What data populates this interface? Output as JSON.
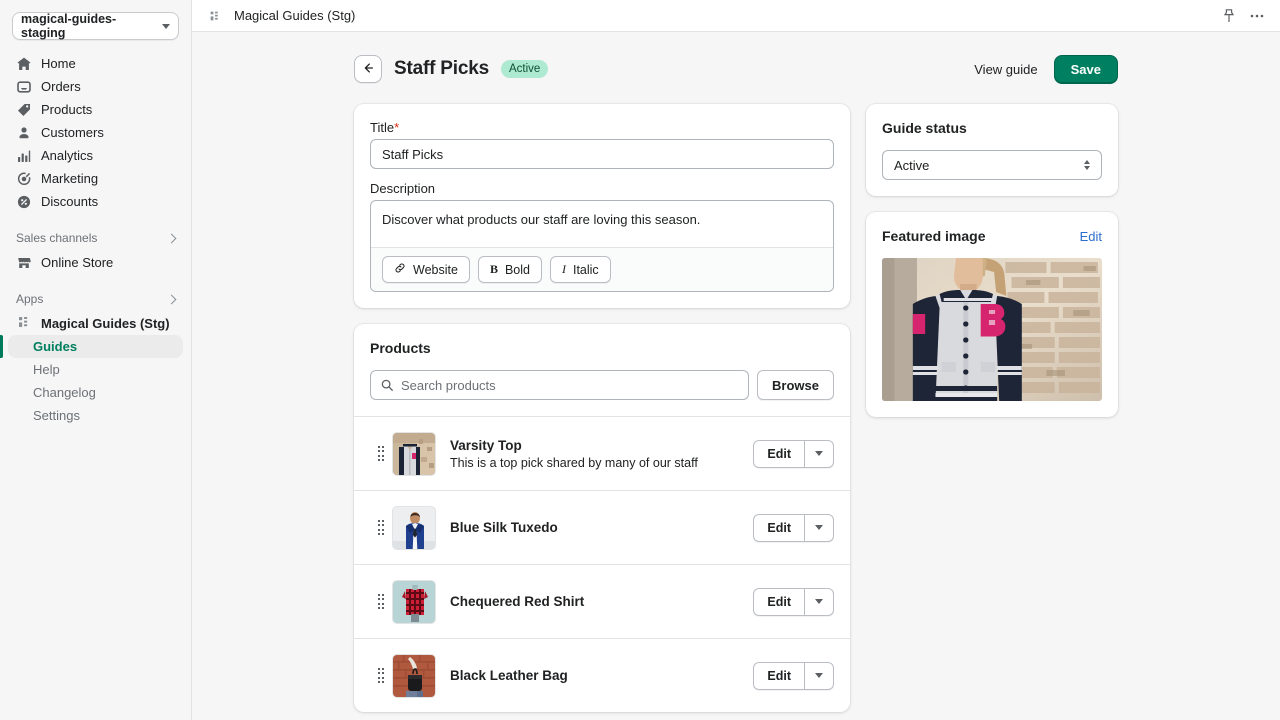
{
  "sidebar": {
    "store_switcher": {
      "label": "magical-guides-staging",
      "icon": "chevron-down-icon"
    },
    "nav_items": [
      {
        "label": "Home",
        "icon": "home-icon"
      },
      {
        "label": "Orders",
        "icon": "orders-inbox-icon"
      },
      {
        "label": "Products",
        "icon": "products-tag-icon"
      },
      {
        "label": "Customers",
        "icon": "customers-person-icon"
      },
      {
        "label": "Analytics",
        "icon": "analytics-bars-icon"
      },
      {
        "label": "Marketing",
        "icon": "marketing-target-icon"
      },
      {
        "label": "Discounts",
        "icon": "discounts-badge-icon"
      }
    ],
    "sales_channels": {
      "label": "Sales channels",
      "icon": "chevron-right-icon"
    },
    "online_store": {
      "label": "Online Store",
      "icon": "storefront-icon"
    },
    "apps_section": {
      "label": "Apps",
      "icon": "chevron-right-icon"
    },
    "app": {
      "label": "Magical Guides (Stg)",
      "icon": "app-grid-icon"
    },
    "app_subnav": [
      {
        "label": "Guides",
        "active": true
      },
      {
        "label": "Help",
        "active": false
      },
      {
        "label": "Changelog",
        "active": false
      },
      {
        "label": "Settings",
        "active": false
      }
    ]
  },
  "topbar": {
    "app_icon": "app-grid-icon",
    "title": "Magical Guides (Stg)",
    "pin_icon": "pin-icon",
    "more_icon": "more-horizontal-icon"
  },
  "page_header": {
    "back_icon": "arrow-left-icon",
    "title": "Staff Picks",
    "status_badge": "Active",
    "view_guide_label": "View guide",
    "save_label": "Save"
  },
  "details_card": {
    "title_label": "Title",
    "title_required": "*",
    "title_value": "Staff Picks",
    "description_label": "Description",
    "description_value": "Discover what products our staff are loving this season.",
    "toolbar": [
      {
        "label": "Website",
        "icon": "link-icon"
      },
      {
        "label": "Bold",
        "icon": "bold-icon"
      },
      {
        "label": "Italic",
        "icon": "italic-icon"
      }
    ]
  },
  "products_card": {
    "title": "Products",
    "search_placeholder": "Search products",
    "search_value": "",
    "search_icon": "search-icon",
    "browse_label": "Browse",
    "row_edit_label": "Edit",
    "row_menu_icon": "chevron-down-icon",
    "drag_handle_icon": "drag-handle-icon",
    "items": [
      {
        "name": "Varsity Top",
        "description": "This is a top pick shared by many of our staff",
        "thumb": "varsity-top-thumbnail"
      },
      {
        "name": "Blue Silk Tuxedo",
        "description": "",
        "thumb": "blue-silk-tuxedo-thumbnail"
      },
      {
        "name": "Chequered Red Shirt",
        "description": "",
        "thumb": "chequered-red-shirt-thumbnail"
      },
      {
        "name": "Black Leather Bag",
        "description": "",
        "thumb": "black-leather-bag-thumbnail"
      }
    ]
  },
  "guide_status_card": {
    "title": "Guide status",
    "selected": "Active"
  },
  "featured_image_card": {
    "title": "Featured image",
    "edit_label": "Edit",
    "image_alt": "varsity-jacket-featured-image"
  },
  "colors": {
    "accent_green": "#008060",
    "badge_bg": "#aee9d1",
    "badge_text": "#0c5132",
    "link_blue": "#2c6ecb",
    "required_red": "#d82c0d",
    "page_bg": "#f6f6f7",
    "card_bg": "#ffffff",
    "border": "#e1e3e5"
  }
}
